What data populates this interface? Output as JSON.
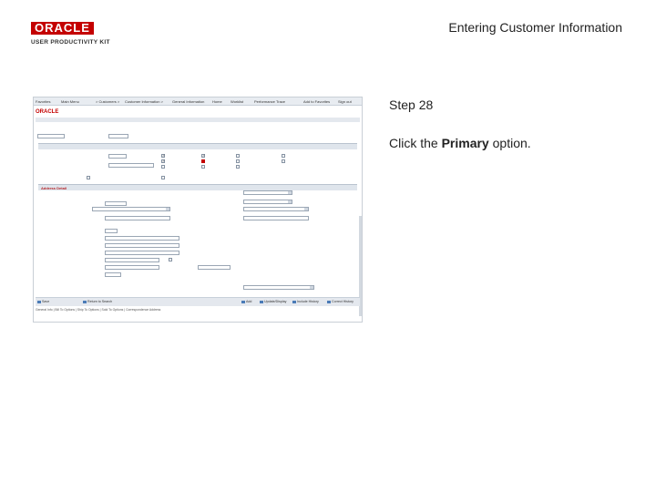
{
  "logo": {
    "brand": "ORACLE",
    "product": "USER PRODUCTIVITY KIT"
  },
  "header": {
    "title": "Entering Customer Information"
  },
  "step": {
    "label": "Step 28"
  },
  "instruction": {
    "prefix": "Click the ",
    "bold": "Primary",
    "suffix": " option."
  },
  "screenshot": {
    "brand": "ORACLE",
    "nav": [
      "Favorites",
      "Main Menu",
      "> Customers >",
      "Customer Information >",
      "General Information",
      "Home",
      "Worklist",
      "Performance Trace",
      "Add to Favorites",
      "Sign out"
    ],
    "address_section": "Address Detail",
    "bottom_buttons": [
      "Save",
      "Return to Search",
      "Add",
      "Update/Display",
      "Include History",
      "Correct History"
    ],
    "footer": "General Info | Bill To Options | Ship To Options | Sold To Options | Correspondence Address"
  }
}
